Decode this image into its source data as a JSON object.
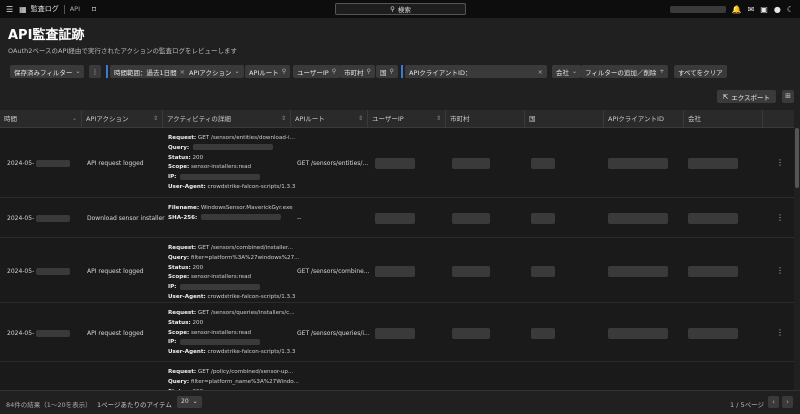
{
  "nav": {
    "brand": "監査ログ",
    "api": "API",
    "search_label": "検索"
  },
  "header": {
    "title": "API監査証跡",
    "subtitle": "OAuth2ベースのAPI経由で実行されたアクションの監査ログをレビューします"
  },
  "filters": {
    "saved": "保存済みフィルター",
    "more": "⋮",
    "time_range": "時間範囲：過去1日間",
    "api_action": "APIアクション",
    "api_route": "APIルート",
    "user_ip": "ユーザーIP",
    "city": "市町村",
    "country": "国",
    "api_client_id": "APIクライアントID：",
    "company": "会社",
    "add_remove": "フィルターの追加／削除",
    "clear_all": "すべてをクリア"
  },
  "toolbar": {
    "export": "エクスポート"
  },
  "table": {
    "columns": [
      "時間",
      "APIアクション",
      "アクティビティの詳細",
      "APIルート",
      "ユーザーIP",
      "市町村",
      "国",
      "APIクライアントID",
      "会社"
    ],
    "rows": [
      {
        "time": "2024-05-",
        "action": "API request logged",
        "route": "GET /sensors/entities/...",
        "details": [
          {
            "k": "Request:",
            "v": "GET /sensors/entities/download-i..."
          },
          {
            "k": "Query:",
            "v": ""
          },
          {
            "k": "Status:",
            "v": "200"
          },
          {
            "k": "Scope:",
            "v": "sensor-installers:read"
          },
          {
            "k": "IP:",
            "v": ""
          },
          {
            "k": "User-Agent:",
            "v": "crowdstrike-falcon-scripts/1.3.3"
          }
        ]
      },
      {
        "time": "2024-05-",
        "action": "Download sensor installer",
        "route": "--",
        "details": [
          {
            "k": "Filename:",
            "v": "WindowsSensor.MaverickGyr.exe"
          },
          {
            "k": "SHA-256:",
            "v": ""
          }
        ]
      },
      {
        "time": "2024-05-",
        "action": "API request logged",
        "route": "GET /sensors/combine...",
        "details": [
          {
            "k": "Request:",
            "v": "GET /sensors/combined/installer..."
          },
          {
            "k": "Query:",
            "v": "filter=platform%3A%27windows%27..."
          },
          {
            "k": "Status:",
            "v": "200"
          },
          {
            "k": "Scope:",
            "v": "sensor-installers:read"
          },
          {
            "k": "IP:",
            "v": ""
          },
          {
            "k": "User-Agent:",
            "v": "crowdstrike-falcon-scripts/1.3.3"
          }
        ]
      },
      {
        "time": "2024-05-",
        "action": "API request logged",
        "route": "GET /sensors/queries/i...",
        "details": [
          {
            "k": "Request:",
            "v": "GET /sensors/queries/installers/c..."
          },
          {
            "k": "Status:",
            "v": "200"
          },
          {
            "k": "Scope:",
            "v": "sensor-installers:read"
          },
          {
            "k": "IP:",
            "v": ""
          },
          {
            "k": "User-Agent:",
            "v": "crowdstrike-falcon-scripts/1.3.3"
          }
        ]
      },
      {
        "time": "",
        "action": "",
        "route": "",
        "details": [
          {
            "k": "Request:",
            "v": "GET /policy/combined/sensor-up..."
          },
          {
            "k": "Query:",
            "v": "filter=platform_name%3A%27Windo..."
          },
          {
            "k": "Status:",
            "v": "200"
          }
        ]
      }
    ]
  },
  "footer": {
    "results": "84件の結果（1〜20を表示）",
    "per_page_label": "1ページあたりのアイテム",
    "per_page_value": "20",
    "pages": "1 / 5ページ"
  }
}
